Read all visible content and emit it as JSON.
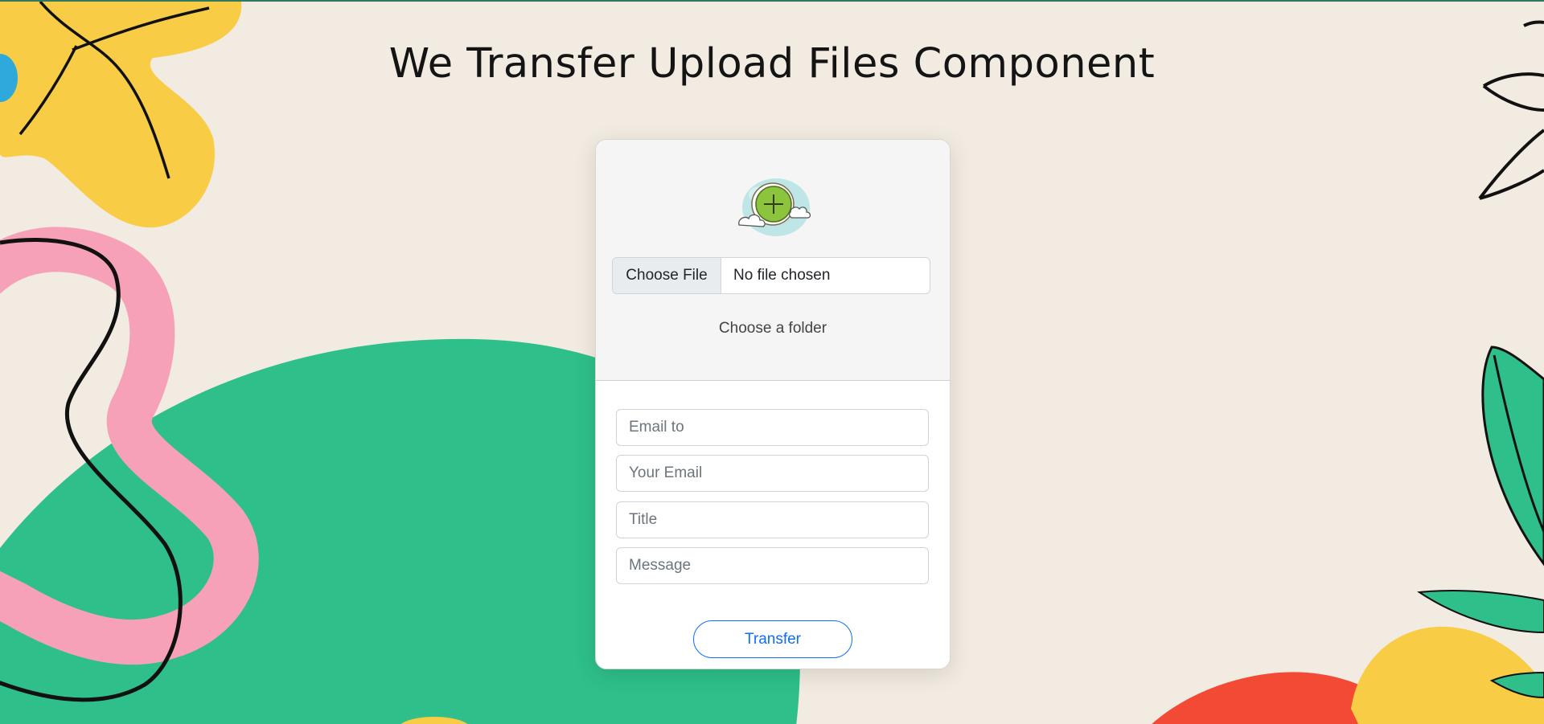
{
  "page": {
    "title": "We Transfer Upload Files Component"
  },
  "upload": {
    "illustration_icon": "cloud-upload-plus-icon",
    "file_button_label": "Choose File",
    "file_status": "No file chosen",
    "folder_link": "Choose a folder"
  },
  "form": {
    "email_to_placeholder": "Email to",
    "your_email_placeholder": "Your Email",
    "title_placeholder": "Title",
    "message_placeholder": "Message",
    "submit_label": "Transfer"
  },
  "colors": {
    "background": "#f2ebe1",
    "accent": "#0d6efd",
    "green_blob": "#2ebf8a",
    "pink_loop": "#f7a1b8",
    "yellow_flower": "#f9cc45",
    "red_blob": "#f24a35"
  }
}
